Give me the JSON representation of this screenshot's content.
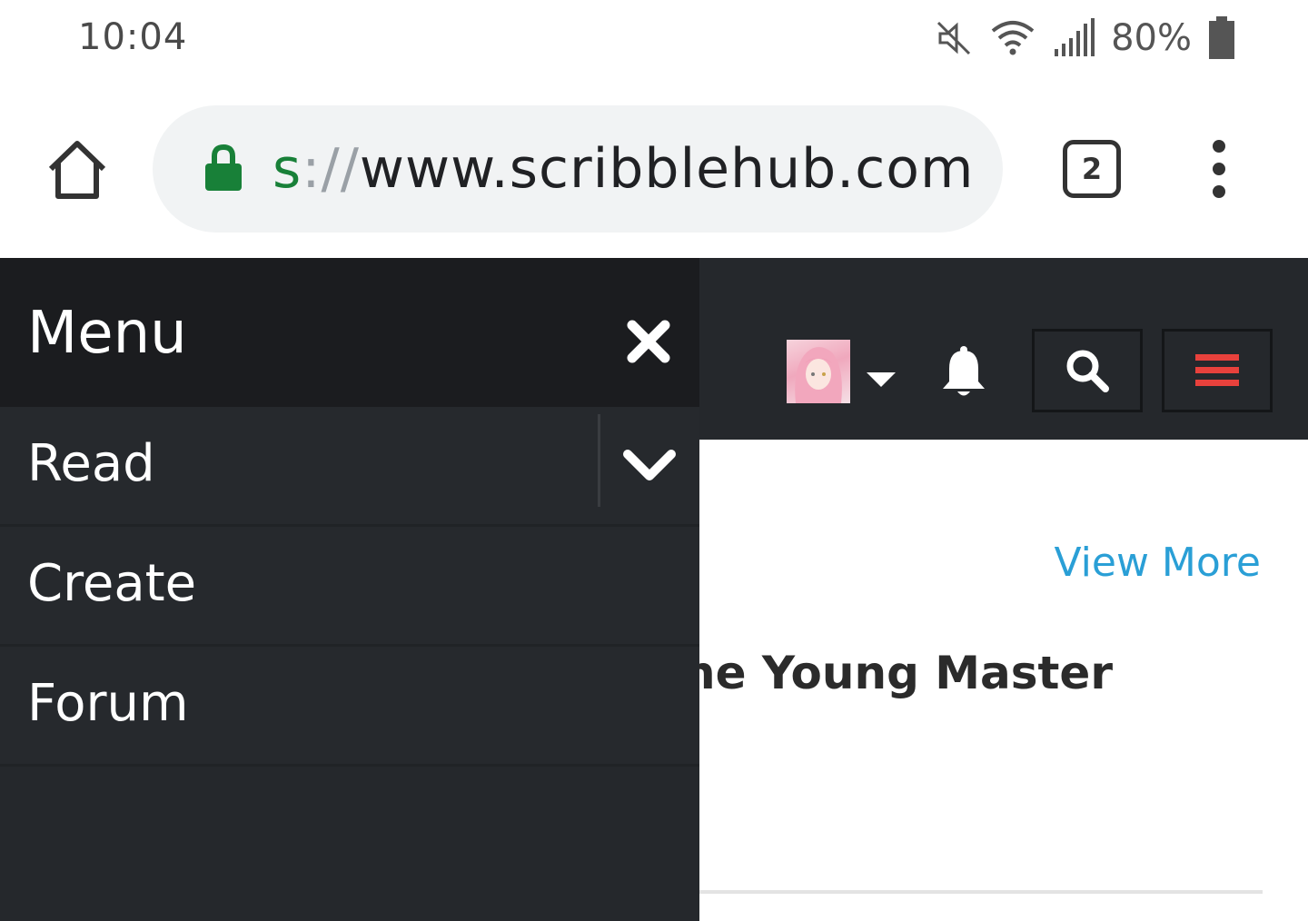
{
  "status_bar": {
    "time": "10:04",
    "battery_percent": "80%",
    "icons": [
      "mute-icon",
      "wifi-icon",
      "signal-icon",
      "battery-icon"
    ]
  },
  "browser": {
    "url_scheme": "s",
    "url_sep": "://",
    "url_host": "www.scribblehub.com",
    "tab_count": "2",
    "icons": [
      "home-icon",
      "lock-icon",
      "tabs-icon",
      "kebab-menu-icon"
    ]
  },
  "site_header": {
    "icons": [
      "avatar",
      "caret-down-icon",
      "bell-icon",
      "search-icon",
      "hamburger-icon"
    ],
    "colors": {
      "background": "#25282c",
      "hamburger": "#e8413c"
    }
  },
  "main": {
    "view_more": "View More",
    "story_title": "he Young Master"
  },
  "side_menu": {
    "title": "Menu",
    "items": [
      {
        "label": "Read",
        "expandable": true
      },
      {
        "label": "Create"
      },
      {
        "label": "Forum"
      }
    ],
    "icons": [
      "close-icon",
      "chevron-down-icon"
    ]
  }
}
